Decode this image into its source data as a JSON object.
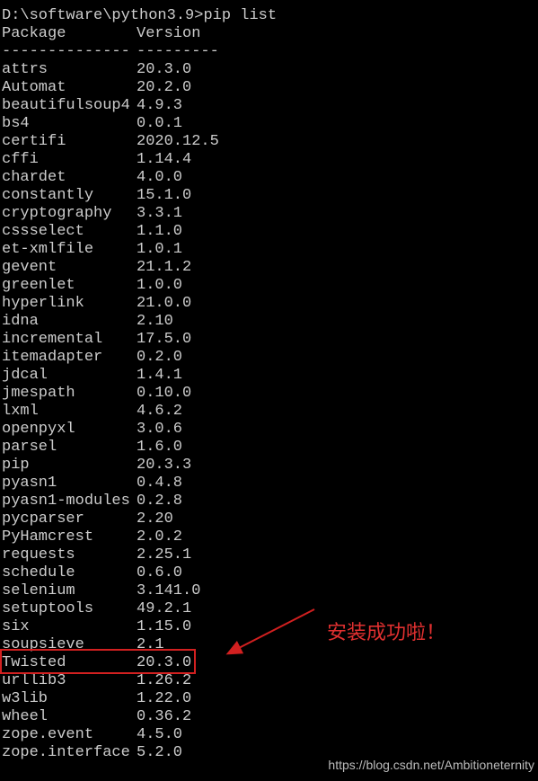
{
  "prompt": {
    "path": "D:\\software\\python3.9",
    "separator": ">",
    "command": "pip list"
  },
  "header": {
    "package_col": "Package",
    "version_col": "Version"
  },
  "separator": {
    "package_sep": "--------------",
    "version_sep": "---------"
  },
  "packages": [
    {
      "name": "attrs",
      "version": "20.3.0"
    },
    {
      "name": "Automat",
      "version": "20.2.0"
    },
    {
      "name": "beautifulsoup4",
      "version": "4.9.3"
    },
    {
      "name": "bs4",
      "version": "0.0.1"
    },
    {
      "name": "certifi",
      "version": "2020.12.5"
    },
    {
      "name": "cffi",
      "version": "1.14.4"
    },
    {
      "name": "chardet",
      "version": "4.0.0"
    },
    {
      "name": "constantly",
      "version": "15.1.0"
    },
    {
      "name": "cryptography",
      "version": "3.3.1"
    },
    {
      "name": "cssselect",
      "version": "1.1.0"
    },
    {
      "name": "et-xmlfile",
      "version": "1.0.1"
    },
    {
      "name": "gevent",
      "version": "21.1.2"
    },
    {
      "name": "greenlet",
      "version": "1.0.0"
    },
    {
      "name": "hyperlink",
      "version": "21.0.0"
    },
    {
      "name": "idna",
      "version": "2.10"
    },
    {
      "name": "incremental",
      "version": "17.5.0"
    },
    {
      "name": "itemadapter",
      "version": "0.2.0"
    },
    {
      "name": "jdcal",
      "version": "1.4.1"
    },
    {
      "name": "jmespath",
      "version": "0.10.0"
    },
    {
      "name": "lxml",
      "version": "4.6.2"
    },
    {
      "name": "openpyxl",
      "version": "3.0.6"
    },
    {
      "name": "parsel",
      "version": "1.6.0"
    },
    {
      "name": "pip",
      "version": "20.3.3"
    },
    {
      "name": "pyasn1",
      "version": "0.4.8"
    },
    {
      "name": "pyasn1-modules",
      "version": "0.2.8"
    },
    {
      "name": "pycparser",
      "version": "2.20"
    },
    {
      "name": "PyHamcrest",
      "version": "2.0.2"
    },
    {
      "name": "requests",
      "version": "2.25.1"
    },
    {
      "name": "schedule",
      "version": "0.6.0"
    },
    {
      "name": "selenium",
      "version": "3.141.0"
    },
    {
      "name": "setuptools",
      "version": "49.2.1"
    },
    {
      "name": "six",
      "version": "1.15.0"
    },
    {
      "name": "soupsieve",
      "version": "2.1"
    },
    {
      "name": "Twisted",
      "version": "20.3.0"
    },
    {
      "name": "urllib3",
      "version": "1.26.2"
    },
    {
      "name": "w3lib",
      "version": "1.22.0"
    },
    {
      "name": "wheel",
      "version": "0.36.2"
    },
    {
      "name": "zope.event",
      "version": "4.5.0"
    },
    {
      "name": "zope.interface",
      "version": "5.2.0"
    }
  ],
  "annotation": {
    "text": "安装成功啦！"
  },
  "watermark": {
    "text": "https://blog.csdn.net/Ambitioneternity"
  }
}
